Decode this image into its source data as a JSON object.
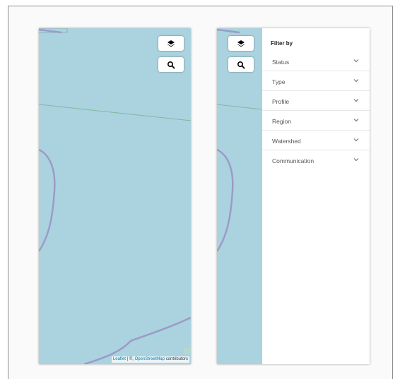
{
  "map": {
    "attribution": {
      "leaflet": "Leaflet",
      "separator": "| ©,",
      "osm": "OpenStreetMap",
      "contributors": "contributors"
    },
    "layers_icon": "layers-icon",
    "search_icon": "search-icon",
    "water_color": "#aad3df",
    "boundary_color": "#9b9bc8"
  },
  "filter": {
    "title": "Filter by",
    "items": [
      {
        "label": "Status"
      },
      {
        "label": "Type"
      },
      {
        "label": "Profile"
      },
      {
        "label": "Region"
      },
      {
        "label": "Watershed"
      },
      {
        "label": "Communication"
      }
    ]
  }
}
